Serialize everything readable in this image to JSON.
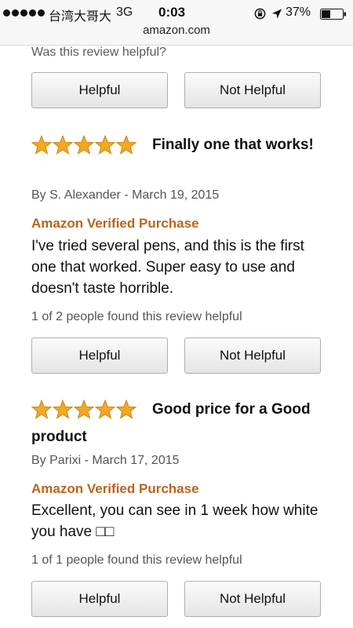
{
  "status_bar": {
    "carrier": "台湾大哥大",
    "network": "3G",
    "time": "0:03",
    "battery": "37%",
    "url": "amazon.com"
  },
  "top": {
    "question": "Was this review helpful?",
    "helpful_label": "Helpful",
    "not_helpful_label": "Not Helpful"
  },
  "reviews": [
    {
      "rating": 5,
      "title": "Finally one that works!",
      "byline": "By S. Alexander - March 19, 2015",
      "verified": "Amazon Verified Purchase",
      "body": "I've tried several pens, and this is the first one that worked. Super easy to use and doesn't taste horrible.",
      "helpful_count": "1 of 2 people found this review helpful",
      "helpful_label": "Helpful",
      "not_helpful_label": "Not Helpful"
    },
    {
      "rating": 5,
      "title": "Good price for a Good product",
      "byline": "By Parixi - March 17, 2015",
      "verified": "Amazon Verified Purchase",
      "body": "Excellent, you can see in 1 week how white you have □□",
      "helpful_count": "1 of 1 people found this review helpful",
      "helpful_label": "Helpful",
      "not_helpful_label": "Not Helpful"
    }
  ],
  "colors": {
    "star": "#f3a823",
    "verified": "#b8651b",
    "status_bar_bg": "#f7f7f7"
  },
  "icons": [
    "signal-dots-icon",
    "orientation-lock-icon",
    "location-arrow-icon",
    "battery-icon",
    "star-icon"
  ]
}
